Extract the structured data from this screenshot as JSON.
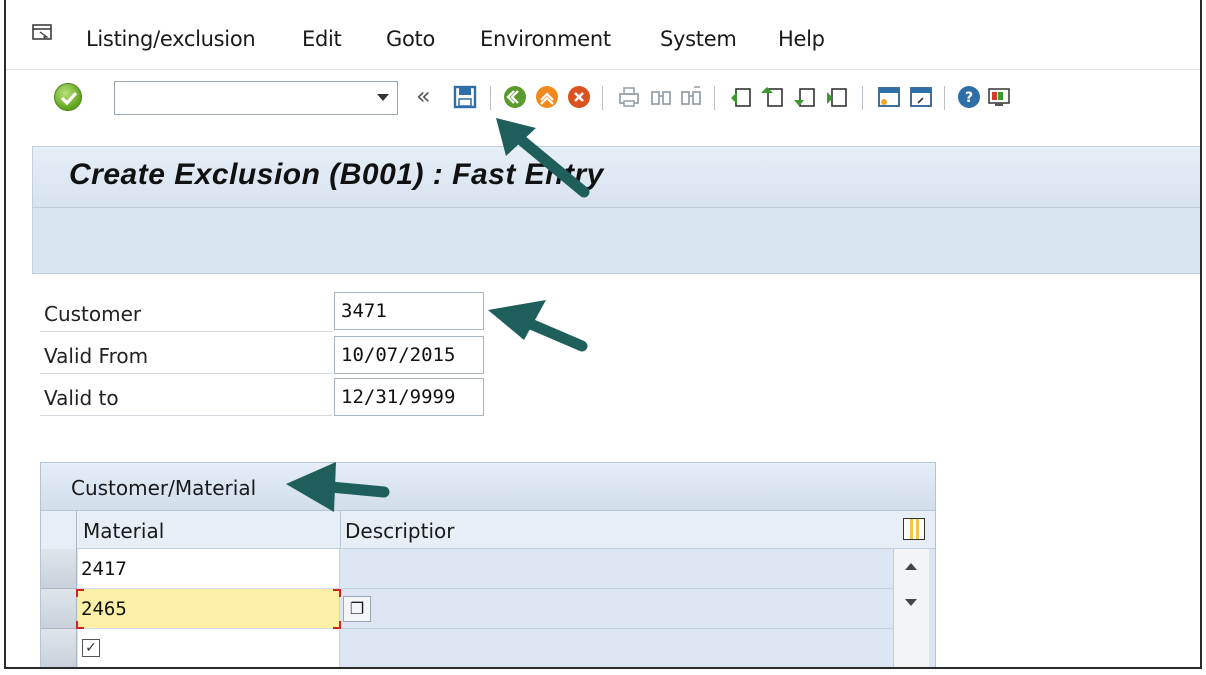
{
  "menu": {
    "items": [
      "Listing/exclusion",
      "Edit",
      "Goto",
      "Environment",
      "System",
      "Help"
    ]
  },
  "toolbar": {
    "command_value": "",
    "back_glyph": "«",
    "icons": [
      "enter-icon",
      "save-icon",
      "back-icon",
      "exit-icon",
      "cancel-icon",
      "print-icon",
      "find-icon",
      "find-next-icon",
      "first-page-icon",
      "previous-page-icon",
      "next-page-icon",
      "last-page-icon",
      "create-session-icon",
      "shortcut-icon",
      "help-icon",
      "layout-icon"
    ]
  },
  "page": {
    "title": "Create Exclusion (B001) : Fast Entry"
  },
  "form": {
    "customer_label": "Customer",
    "customer_value": "3471",
    "valid_from_label": "Valid From",
    "valid_from_value": "10/07/2015",
    "valid_to_label": "Valid to",
    "valid_to_value": "12/31/9999"
  },
  "table": {
    "title": "Customer/Material",
    "columns": [
      "Material",
      "Descriptior"
    ],
    "rows": [
      {
        "material": "2417",
        "description": ""
      },
      {
        "material": "2465",
        "description": ""
      },
      {
        "material": "",
        "description": ""
      }
    ]
  },
  "colors": {
    "title_band": "#d7e3ef",
    "table_bg": "#dbe6f2",
    "active_cell": "#fbf0a6",
    "annotation_arrow": "#1e5f5c"
  }
}
